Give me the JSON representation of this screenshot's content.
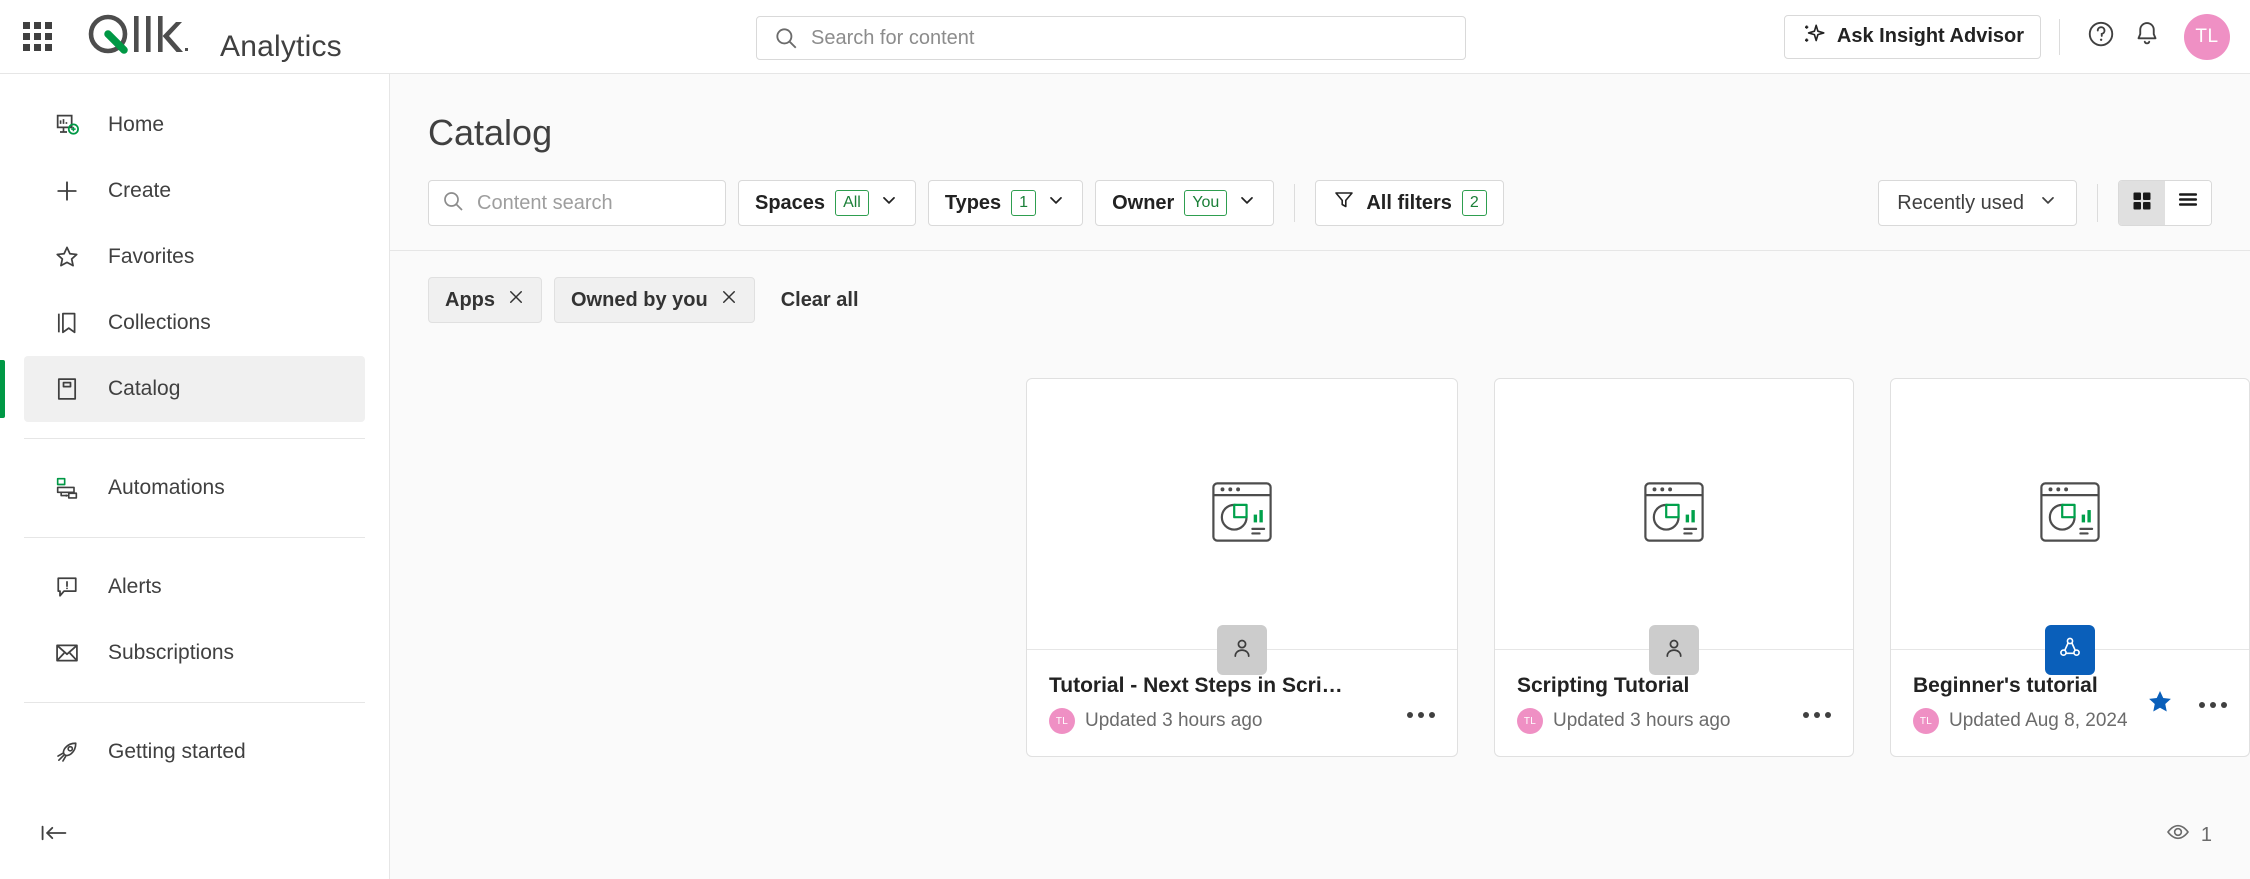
{
  "header": {
    "brand": "Analytics",
    "launcher_icon": "app-launcher-grid-icon",
    "logo_text": "Qlik",
    "search": {
      "value": "",
      "placeholder": "Search for content"
    },
    "insight_advisor_label": "Ask Insight Advisor",
    "help_icon": "help-circle-icon",
    "notifications_icon": "bell-icon",
    "avatar_initials": "TL"
  },
  "sidebar": {
    "items": [
      {
        "label": "Home",
        "icon": "home-dashboard-icon",
        "active": false
      },
      {
        "label": "Create",
        "icon": "plus-icon",
        "active": false
      },
      {
        "label": "Favorites",
        "icon": "star-outline-icon",
        "active": false
      },
      {
        "label": "Collections",
        "icon": "bookmark-icon",
        "active": false
      },
      {
        "label": "Catalog",
        "icon": "catalog-book-icon",
        "active": true
      },
      {
        "label": "Automations",
        "icon": "automations-flow-icon",
        "active": false
      },
      {
        "label": "Alerts",
        "icon": "alert-bubble-icon",
        "active": false
      },
      {
        "label": "Subscriptions",
        "icon": "envelope-icon",
        "active": false
      },
      {
        "label": "Getting started",
        "icon": "rocket-icon",
        "active": false
      }
    ],
    "collapse_icon": "collapse-sidebar-icon"
  },
  "main": {
    "page_title": "Catalog",
    "toolbar": {
      "content_search": {
        "value": "",
        "placeholder": "Content search"
      },
      "spaces": {
        "label": "Spaces",
        "badge": "All"
      },
      "types": {
        "label": "Types",
        "badge": "1"
      },
      "owner": {
        "label": "Owner",
        "badge": "You"
      },
      "all_filters": {
        "label": "All filters",
        "badge": "2",
        "icon": "funnel-icon"
      },
      "sort": {
        "label": "Recently used"
      },
      "view_grid": {
        "icon": "grid-view-icon",
        "active": true
      },
      "view_list": {
        "icon": "list-view-icon",
        "active": false
      }
    },
    "chips": [
      {
        "label": "Apps",
        "remove_icon": "close-icon"
      },
      {
        "label": "Owned by you",
        "remove_icon": "close-icon"
      }
    ],
    "clear_all_label": "Clear all",
    "cards": [
      {
        "title": "Tutorial - Next Steps in Scripting",
        "updated": "Updated 3 hours ago",
        "owner_initials": "TL",
        "space_type": "personal",
        "space_icon": "person-icon",
        "thumb_icon": "app-chart-placeholder-icon",
        "favorited": false,
        "menu_icon": "more-options-icon"
      },
      {
        "title": "Scripting Tutorial",
        "updated": "Updated 3 hours ago",
        "owner_initials": "TL",
        "space_type": "personal",
        "space_icon": "person-icon",
        "thumb_icon": "app-chart-placeholder-icon",
        "favorited": false,
        "menu_icon": "more-options-icon"
      },
      {
        "title": "Beginner's tutorial",
        "updated": "Updated Aug 8, 2024",
        "owner_initials": "TL",
        "space_type": "shared",
        "space_icon": "shared-space-icon",
        "thumb_icon": "app-chart-placeholder-icon",
        "favorited": true,
        "favorite_icon": "star-filled-icon",
        "menu_icon": "more-options-icon"
      }
    ],
    "footer": {
      "icon": "eye-icon",
      "count": "1"
    }
  },
  "colors": {
    "accent_green": "#009845",
    "badge_green": "#1a7f37",
    "avatar_pink": "#ef90c4",
    "shared_blue": "#0a5fba",
    "star_blue": "#0a5fba",
    "text_primary": "#404040",
    "bg_canvas": "#fafafa"
  }
}
